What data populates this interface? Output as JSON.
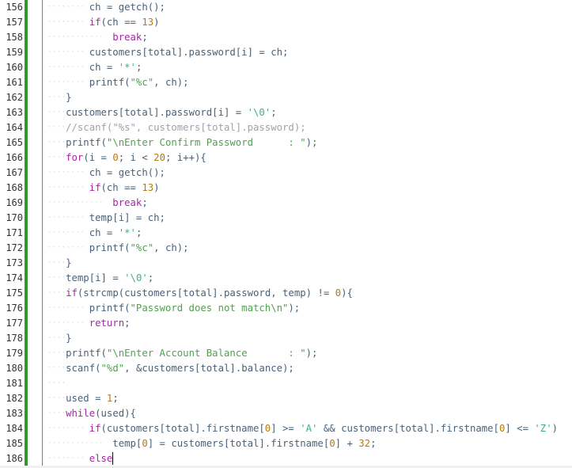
{
  "editor": {
    "language": "c",
    "cursor_line": 186,
    "colors": {
      "text": "#4a6178",
      "keyword": "#a626a4",
      "number": "#b37a10",
      "string": "#50a14f",
      "char_literal": "#3fae8f",
      "comment": "#a0a1a7",
      "gutter_marker": "#2e9a2e"
    },
    "lines": [
      {
        "n": "156",
        "indent": 2,
        "tokens": [
          [
            "t",
            "ch = getch();"
          ]
        ]
      },
      {
        "n": "157",
        "indent": 2,
        "tokens": [
          [
            "k",
            "if"
          ],
          [
            "t",
            "(ch == "
          ],
          [
            "n",
            "13"
          ],
          [
            "t",
            ")"
          ]
        ]
      },
      {
        "n": "158",
        "indent": 3,
        "tokens": [
          [
            "k",
            "break"
          ],
          [
            "t",
            ";"
          ]
        ]
      },
      {
        "n": "159",
        "indent": 2,
        "tokens": [
          [
            "t",
            "customers[total].password[i] = ch;"
          ]
        ]
      },
      {
        "n": "160",
        "indent": 2,
        "tokens": [
          [
            "t",
            "ch = "
          ],
          [
            "c",
            "'*'"
          ],
          [
            "t",
            ";"
          ]
        ]
      },
      {
        "n": "161",
        "indent": 2,
        "tokens": [
          [
            "t",
            "printf("
          ],
          [
            "s",
            "\"%c\""
          ],
          [
            "t",
            ", ch);"
          ]
        ]
      },
      {
        "n": "162",
        "indent": 1,
        "tokens": [
          [
            "t",
            "}"
          ]
        ]
      },
      {
        "n": "163",
        "indent": 1,
        "tokens": [
          [
            "t",
            "customers[total].password[i] = "
          ],
          [
            "c",
            "'\\0'"
          ],
          [
            "t",
            ";"
          ]
        ]
      },
      {
        "n": "164",
        "indent": 1,
        "tokens": [
          [
            "m",
            "//scanf(\"%s\", customers[total].password);"
          ]
        ]
      },
      {
        "n": "165",
        "indent": 1,
        "tokens": [
          [
            "t",
            "printf("
          ],
          [
            "s",
            "\"\\nEnter Confirm Password      : \""
          ],
          [
            "t",
            ");"
          ]
        ]
      },
      {
        "n": "166",
        "indent": 1,
        "tokens": [
          [
            "k",
            "for"
          ],
          [
            "t",
            "(i = "
          ],
          [
            "n",
            "0"
          ],
          [
            "t",
            "; i < "
          ],
          [
            "n",
            "20"
          ],
          [
            "t",
            "; i++){"
          ]
        ]
      },
      {
        "n": "167",
        "indent": 2,
        "tokens": [
          [
            "t",
            "ch = getch();"
          ]
        ]
      },
      {
        "n": "168",
        "indent": 2,
        "tokens": [
          [
            "k",
            "if"
          ],
          [
            "t",
            "(ch == "
          ],
          [
            "n",
            "13"
          ],
          [
            "t",
            ")"
          ]
        ]
      },
      {
        "n": "169",
        "indent": 3,
        "tokens": [
          [
            "k",
            "break"
          ],
          [
            "t",
            ";"
          ]
        ]
      },
      {
        "n": "170",
        "indent": 2,
        "tokens": [
          [
            "t",
            "temp[i] = ch;"
          ]
        ]
      },
      {
        "n": "171",
        "indent": 2,
        "tokens": [
          [
            "t",
            "ch = "
          ],
          [
            "c",
            "'*'"
          ],
          [
            "t",
            ";"
          ]
        ]
      },
      {
        "n": "172",
        "indent": 2,
        "tokens": [
          [
            "t",
            "printf("
          ],
          [
            "s",
            "\"%c\""
          ],
          [
            "t",
            ", ch);"
          ]
        ]
      },
      {
        "n": "173",
        "indent": 1,
        "tokens": [
          [
            "t",
            "}"
          ]
        ]
      },
      {
        "n": "174",
        "indent": 1,
        "tokens": [
          [
            "t",
            "temp[i] = "
          ],
          [
            "c",
            "'\\0'"
          ],
          [
            "t",
            ";"
          ]
        ]
      },
      {
        "n": "175",
        "indent": 1,
        "tokens": [
          [
            "k",
            "if"
          ],
          [
            "t",
            "(strcmp(customers[total].password, temp) != "
          ],
          [
            "n",
            "0"
          ],
          [
            "t",
            "){"
          ]
        ]
      },
      {
        "n": "176",
        "indent": 2,
        "tokens": [
          [
            "t",
            "printf("
          ],
          [
            "s",
            "\"Password does not match\\n\""
          ],
          [
            "t",
            ");"
          ]
        ]
      },
      {
        "n": "177",
        "indent": 2,
        "tokens": [
          [
            "k",
            "return"
          ],
          [
            "t",
            ";"
          ]
        ]
      },
      {
        "n": "178",
        "indent": 1,
        "tokens": [
          [
            "t",
            "}"
          ]
        ]
      },
      {
        "n": "179",
        "indent": 1,
        "tokens": [
          [
            "t",
            "printf("
          ],
          [
            "s",
            "\"\\nEnter Account Balance       : \""
          ],
          [
            "t",
            ");"
          ]
        ]
      },
      {
        "n": "180",
        "indent": 1,
        "tokens": [
          [
            "t",
            "scanf("
          ],
          [
            "s",
            "\"%d\""
          ],
          [
            "t",
            ", &customers[total].balance);"
          ]
        ]
      },
      {
        "n": "181",
        "indent": 1,
        "tokens": []
      },
      {
        "n": "182",
        "indent": 1,
        "tokens": [
          [
            "t",
            "used = "
          ],
          [
            "n",
            "1"
          ],
          [
            "t",
            ";"
          ]
        ]
      },
      {
        "n": "183",
        "indent": 1,
        "tokens": [
          [
            "k",
            "while"
          ],
          [
            "t",
            "(used){"
          ]
        ]
      },
      {
        "n": "184",
        "indent": 2,
        "tokens": [
          [
            "k",
            "if"
          ],
          [
            "t",
            "(customers[total].firstname["
          ],
          [
            "n",
            "0"
          ],
          [
            "t",
            "] >= "
          ],
          [
            "c",
            "'A'"
          ],
          [
            "t",
            " && customers[total].firstname["
          ],
          [
            "n",
            "0"
          ],
          [
            "t",
            "] <= "
          ],
          [
            "c",
            "'Z'"
          ],
          [
            "t",
            ")"
          ]
        ]
      },
      {
        "n": "185",
        "indent": 3,
        "tokens": [
          [
            "t",
            "temp["
          ],
          [
            "n",
            "0"
          ],
          [
            "t",
            "] = customers[total].firstname["
          ],
          [
            "n",
            "0"
          ],
          [
            "t",
            "] + "
          ],
          [
            "n",
            "32"
          ],
          [
            "t",
            ";"
          ]
        ]
      },
      {
        "n": "186",
        "indent": 2,
        "tokens": [
          [
            "k",
            "else"
          ]
        ]
      }
    ]
  }
}
